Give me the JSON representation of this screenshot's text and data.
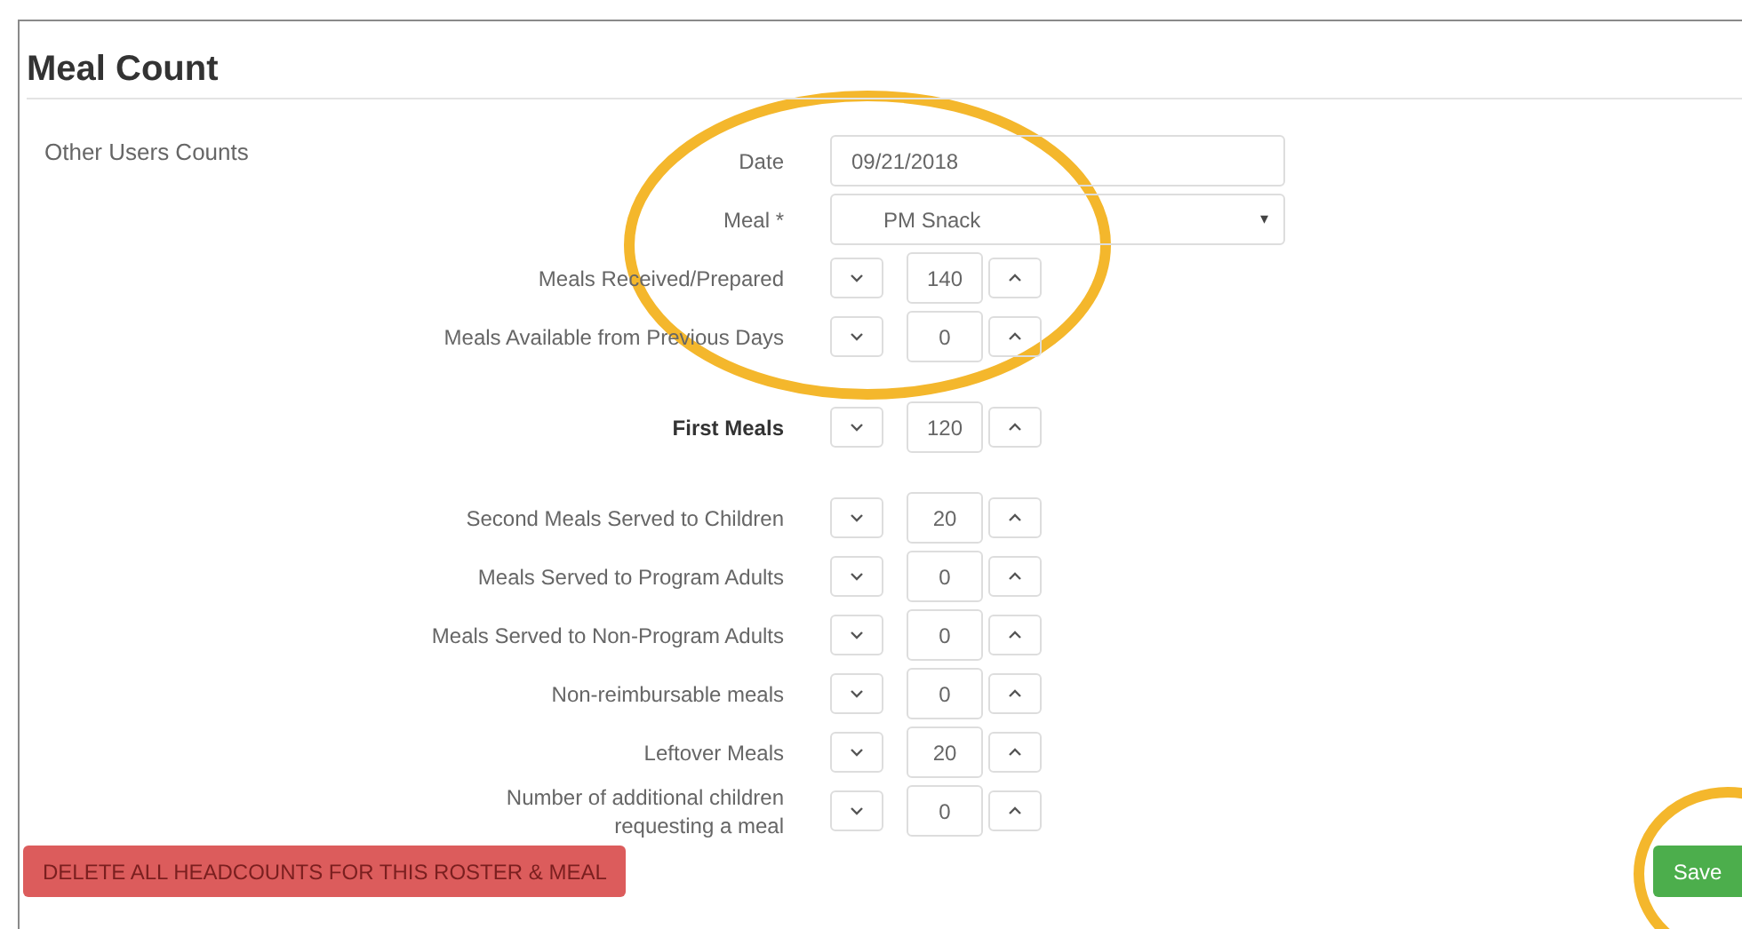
{
  "title": "Meal Count",
  "sidebar": {
    "label": "Other Users Counts"
  },
  "date": {
    "label": "Date",
    "value": "09/21/2018"
  },
  "meal": {
    "label": "Meal *",
    "value": "PM Snack",
    "arrow": "▾"
  },
  "counters": [
    {
      "label": "Meals Received/Prepared",
      "value": "140",
      "kind": "normal"
    },
    {
      "label": "Meals Available from Previous Days",
      "value": "0",
      "kind": "normal"
    },
    {
      "label": "First Meals",
      "value": "120",
      "kind": "total"
    },
    {
      "label": "Second Meals Served to Children",
      "value": "20",
      "kind": "normal"
    },
    {
      "label": "Meals Served to Program Adults",
      "value": "0",
      "kind": "normal"
    },
    {
      "label": "Meals Served to Non-Program Adults",
      "value": "0",
      "kind": "normal"
    },
    {
      "label": "Non-reimbursable meals",
      "value": "0",
      "kind": "normal"
    },
    {
      "label": "Leftover Meals",
      "value": "20",
      "kind": "normal"
    },
    {
      "label": "Number of additional children requesting a meal",
      "value": "0",
      "kind": "normal"
    }
  ],
  "buttons": {
    "delete": "DELETE ALL HEADCOUNTS FOR THIS ROSTER & MEAL",
    "save": "Save"
  }
}
